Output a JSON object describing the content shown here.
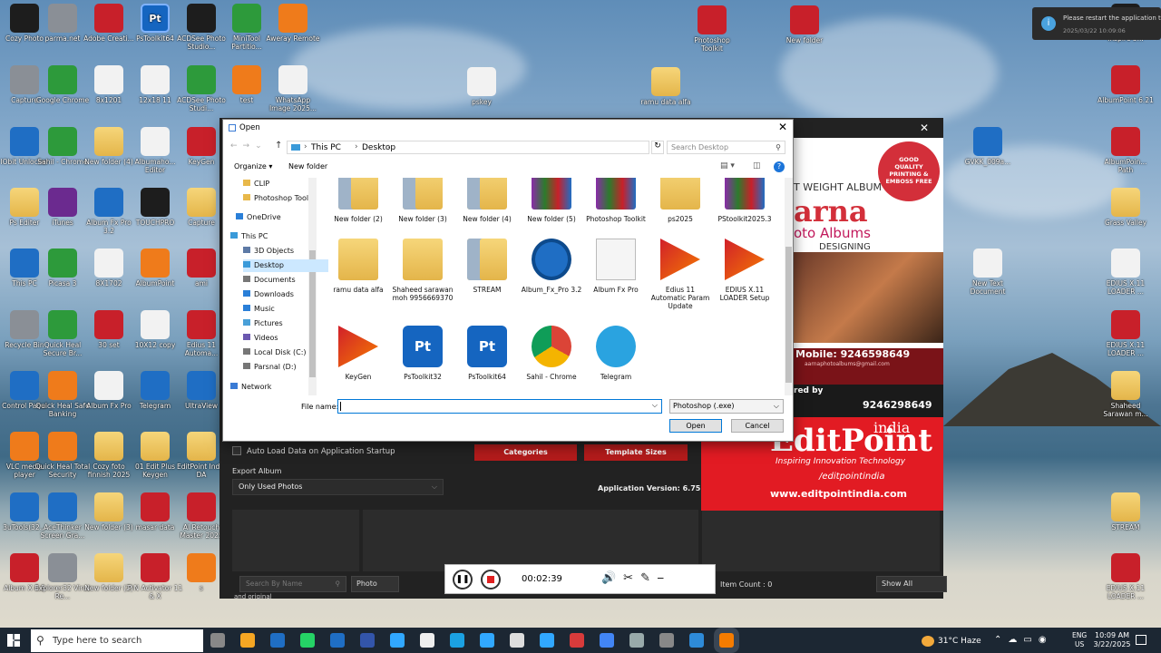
{
  "desktop_left": [
    {
      "label": "Cozy Photo",
      "c": "dark"
    },
    {
      "label": "parma.net",
      "c": "gry"
    },
    {
      "label": "Adobe Creati...",
      "c": "red"
    },
    {
      "label": "PsToolkit64",
      "c": "pt",
      "g": "Pt"
    },
    {
      "label": "ACDSee Photo Studio...",
      "c": "dark"
    },
    {
      "label": "MiniTool Partitio...",
      "c": "grn"
    },
    {
      "label": "Aweray Remote",
      "c": "org"
    },
    {
      "label": "Capture",
      "c": "gry"
    },
    {
      "label": "Google Chrome",
      "c": "grn"
    },
    {
      "label": "8x1201",
      "c": "wht"
    },
    {
      "label": "12x18 11",
      "c": "wht"
    },
    {
      "label": "ACDSee Photo Studi...",
      "c": "grn"
    },
    {
      "label": "test",
      "c": "org"
    },
    {
      "label": "WhatsApp Image 2025...",
      "c": "wht"
    },
    {
      "label": "IObit Unlocker",
      "c": "blu"
    },
    {
      "label": "Sahil - Chrome",
      "c": "grn"
    },
    {
      "label": "New folder (4)",
      "c": "fold"
    },
    {
      "label": "Albumaho... Editor",
      "c": "wht"
    },
    {
      "label": "KeyGen",
      "c": "red"
    },
    {
      "label": "Ps Editer",
      "c": "fold"
    },
    {
      "label": "iTunes",
      "c": "pur"
    },
    {
      "label": "Album Fx Pro 3.2",
      "c": "blu"
    },
    {
      "label": "TOUCHPRO",
      "c": "dark"
    },
    {
      "label": "Capture",
      "c": "fold"
    },
    {
      "label": "This PC",
      "c": "blu"
    },
    {
      "label": "Picasa 3",
      "c": "grn"
    },
    {
      "label": "8X1702",
      "c": "wht"
    },
    {
      "label": "AlbumPoint",
      "c": "org"
    },
    {
      "label": "ami",
      "c": "red"
    },
    {
      "label": "Recycle Bin",
      "c": "gry"
    },
    {
      "label": "Quick Heal Secure Br...",
      "c": "grn"
    },
    {
      "label": "30 set",
      "c": "red"
    },
    {
      "label": "10X12 copy",
      "c": "wht"
    },
    {
      "label": "Edius 11 Automa...",
      "c": "red"
    },
    {
      "label": "Control Panel",
      "c": "blu"
    },
    {
      "label": "Quick Heal Safe Banking",
      "c": "org"
    },
    {
      "label": "Album Fx Pro",
      "c": "wht"
    },
    {
      "label": "Telegram",
      "c": "blu"
    },
    {
      "label": "UltraView",
      "c": "blu"
    },
    {
      "label": "VLC media player",
      "c": "org"
    },
    {
      "label": "Quick Heal Total Security",
      "c": "org"
    },
    {
      "label": "Cozy foto finnish 2025",
      "c": "fold"
    },
    {
      "label": "01 Edit Plus Keygen",
      "c": "fold"
    },
    {
      "label": "EditPoint India DA",
      "c": "fold"
    },
    {
      "label": "3uTools(32...",
      "c": "blu"
    },
    {
      "label": "AceThinker Screen Gra...",
      "c": "blu"
    },
    {
      "label": "New folder (3)",
      "c": "fold"
    },
    {
      "label": "masar data",
      "c": "red"
    },
    {
      "label": "AI Retouch Master 2025",
      "c": "red"
    },
    {
      "label": "Album X 4.5",
      "c": "red"
    },
    {
      "label": "Explorer32 Virus Re...",
      "c": "gry"
    },
    {
      "label": "New folder (2)",
      "c": "fold"
    },
    {
      "label": "P N Activator 11 & X",
      "c": "red"
    },
    {
      "label": "s",
      "c": "org"
    }
  ],
  "desktop_right": [
    {
      "label": "Inspire 3...",
      "c": "dark"
    },
    {
      "label": "AlbumPoint 6.21",
      "c": "red"
    },
    {
      "label": "AlbumPoin... Path",
      "c": "red"
    },
    {
      "label": "Grass Valley",
      "c": "fold"
    },
    {
      "label": "EDIUS X.11 LOADER ...",
      "c": "wht"
    },
    {
      "label": "EDIUS X.11 LOADER ...",
      "c": "red"
    },
    {
      "label": "Shaheed Sarawan m...",
      "c": "fold"
    },
    {
      "label": "STREAM",
      "c": "fold"
    },
    {
      "label": "EDIUS X.11 LOADER ...",
      "c": "red"
    }
  ],
  "desktop_mid": [
    {
      "label": "Photoshop Toolkit",
      "c": "red"
    },
    {
      "label": "New folder",
      "c": "red"
    },
    {
      "label": "pskey",
      "c": "wht"
    },
    {
      "label": "ramu data alfa",
      "c": "fold"
    },
    {
      "label": "GVKK_009a...",
      "c": "blu"
    },
    {
      "label": "New Text Document",
      "c": "wht"
    }
  ],
  "notification": {
    "text": "Please restart the application to a...",
    "time": "2025/03/22 10:09:06"
  },
  "dialog": {
    "title": "Open",
    "path": [
      "This PC",
      "Desktop"
    ],
    "search_placeholder": "Search Desktop",
    "organize": "Organize",
    "new_folder": "New folder",
    "nav": [
      "CLIP",
      "Photoshop Tool",
      "OneDrive",
      "This PC",
      "3D Objects",
      "Desktop",
      "Documents",
      "Downloads",
      "Music",
      "Pictures",
      "Videos",
      "Local Disk (C:)",
      "Parsnal (D:)",
      "Network"
    ],
    "files": [
      {
        "label": "New folder (2)",
        "t": "foldimg"
      },
      {
        "label": "New folder (3)",
        "t": "foldimg"
      },
      {
        "label": "New folder (4)",
        "t": "foldimg"
      },
      {
        "label": "New folder (5)",
        "t": "rar"
      },
      {
        "label": "Photoshop Toolkit",
        "t": "rar"
      },
      {
        "label": "ps2025",
        "t": "fold"
      },
      {
        "label": "PStoolkit2025.3",
        "t": "rar"
      },
      {
        "label": "ramu data alfa",
        "t": "fold"
      },
      {
        "label": "Shaheed sarawan moh 9956669370",
        "t": "fold"
      },
      {
        "label": "STREAM",
        "t": "foldimg"
      },
      {
        "label": "Album_Fx_Pro 3.2",
        "t": "afx"
      },
      {
        "label": "Album Fx Pro",
        "t": "doc"
      },
      {
        "label": "Edius 11 Automatic Param Update",
        "t": "edius"
      },
      {
        "label": "EDIUS X.11 LOADER Setup",
        "t": "edius"
      },
      {
        "label": "KeyGen",
        "t": "edius"
      },
      {
        "label": "PsToolkit32",
        "t": "pt"
      },
      {
        "label": "PsToolkit64",
        "t": "pt"
      },
      {
        "label": "Sahil - Chrome",
        "t": "chrome"
      },
      {
        "label": "Telegram",
        "t": "tg"
      }
    ],
    "file_name_label": "File name:",
    "file_name_value": "",
    "file_type": "Photoshop (.exe)",
    "open": "Open",
    "cancel": "Cancel"
  },
  "app": {
    "auto_load": "Auto Load Data on Application Startup",
    "export_album": "Export Album",
    "export_value": "Only Used Photos",
    "categories": "Categories",
    "template_sizes": "Template Sizes",
    "version": "Application Version: 6.75",
    "search_placeholder": "Search By Name",
    "photo": "Photo",
    "item_count": "Item Count : 0",
    "show_all": "Show All",
    "bottom_text": "and original"
  },
  "ad": {
    "text1": "T WEIGHT ALBUM",
    "text2": "arna",
    "text3": "oto Albums",
    "text4": "DESIGNING",
    "badge": "GOOD QUALITY PRINTING & EMBOSS FREE",
    "mobile": "Mobile: 9246598649",
    "email": "aarnaphotoalbums@gmail.com",
    "powered": "red by",
    "phone": "9246298649",
    "brand": "EditPoint",
    "tagline": "Inspiring Innovation Technology",
    "social": "/editpointindia",
    "web": "www.editpointindia.com",
    "india": "india"
  },
  "recorder": {
    "time": "00:02:39"
  },
  "taskbar": {
    "search": "Type here to search",
    "weather": "31°C  Haze",
    "lang1": "ENG",
    "lang2": "US",
    "time": "10:09 AM",
    "date": "3/22/2025"
  }
}
